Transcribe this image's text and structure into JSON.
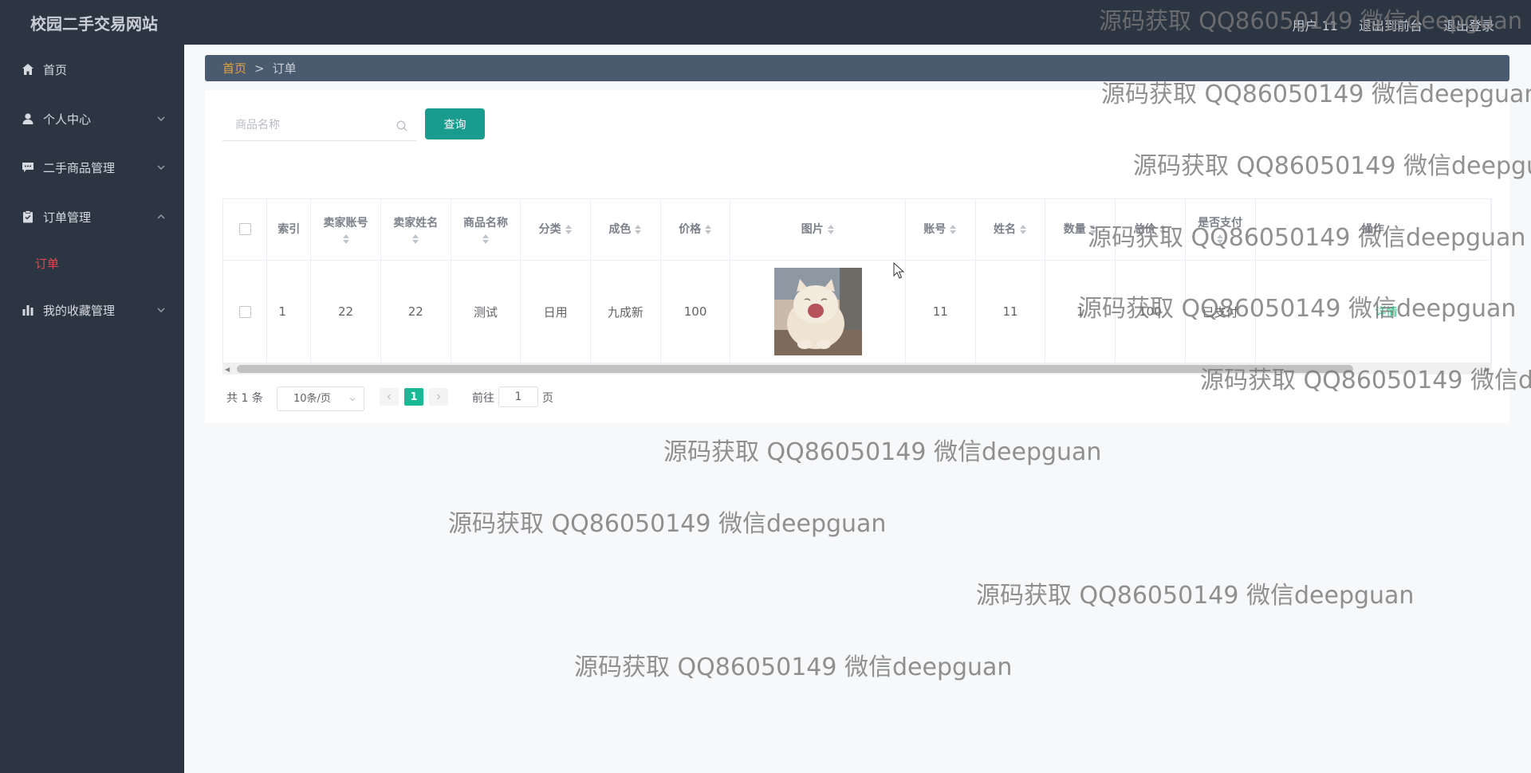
{
  "header": {
    "brand": "校园二手交易网站",
    "links": [
      "用户 11",
      "退出到前台",
      "退出登录"
    ]
  },
  "sidebar": {
    "items": [
      {
        "label": "首页",
        "icon": "home-icon"
      },
      {
        "label": "个人中心",
        "icon": "user-icon"
      },
      {
        "label": "二手商品管理",
        "icon": "chat-icon"
      },
      {
        "label": "订单管理",
        "icon": "clipboard-icon"
      },
      {
        "label": "我的收藏管理",
        "icon": "bar-chart-icon"
      }
    ],
    "sub_item": "订单"
  },
  "breadcrumb": {
    "home": "首页",
    "separator": ">",
    "current": "订单"
  },
  "search": {
    "placeholder": "商品名称",
    "value": "",
    "button": "查询"
  },
  "table": {
    "columns": [
      "索引",
      "卖家账号",
      "卖家姓名",
      "商品名称",
      "分类",
      "成色",
      "价格",
      "图片",
      "账号",
      "姓名",
      "数量",
      "总价",
      "是否支付",
      "操作"
    ],
    "rows": [
      {
        "index": "1",
        "seller_account": "22",
        "seller_name": "22",
        "product": "测试",
        "category": "日用",
        "condition": "九成新",
        "price": "100",
        "image": "cat-photo",
        "account": "11",
        "name": "11",
        "quantity": "1",
        "total": "100",
        "paid": "已支付",
        "action": "详情"
      }
    ]
  },
  "pagination": {
    "total_text": "共 1 条",
    "page_size": "10条/页",
    "current_page": "1",
    "goto_prefix": "前往",
    "goto_value": "1",
    "goto_suffix": "页"
  },
  "watermark": "源码获取 QQ86050149 微信deepguan",
  "colors": {
    "sidebar_bg": "#2c3643",
    "breadcrumb_bg": "#4a5b70",
    "primary_button": "#199c8e",
    "active_page": "#19b995",
    "active_submenu": "#e0484a",
    "breadcrumb_home": "#e6a23c"
  }
}
